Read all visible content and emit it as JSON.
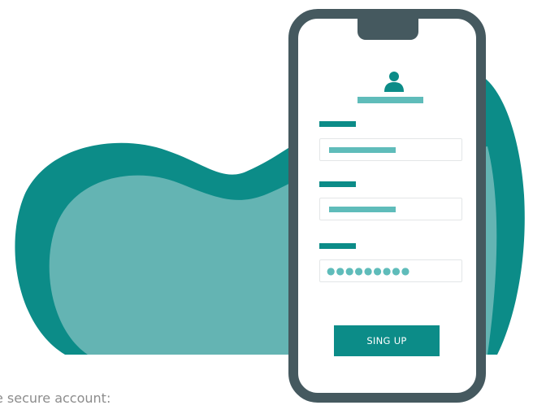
{
  "caption": {
    "text": "e secure account:"
  },
  "form": {
    "password_mask": "●●●●●●●●●",
    "submit_label": "SING UP"
  },
  "icons": {
    "user": "user-icon"
  },
  "colors": {
    "teal_dark": "#0c8c88",
    "teal_light": "#5fbcba",
    "blob_inner": "#64b4b3",
    "phone_frame": "#45595f",
    "field_border": "#e3e6e7",
    "caption_text": "#8c8c8c"
  }
}
